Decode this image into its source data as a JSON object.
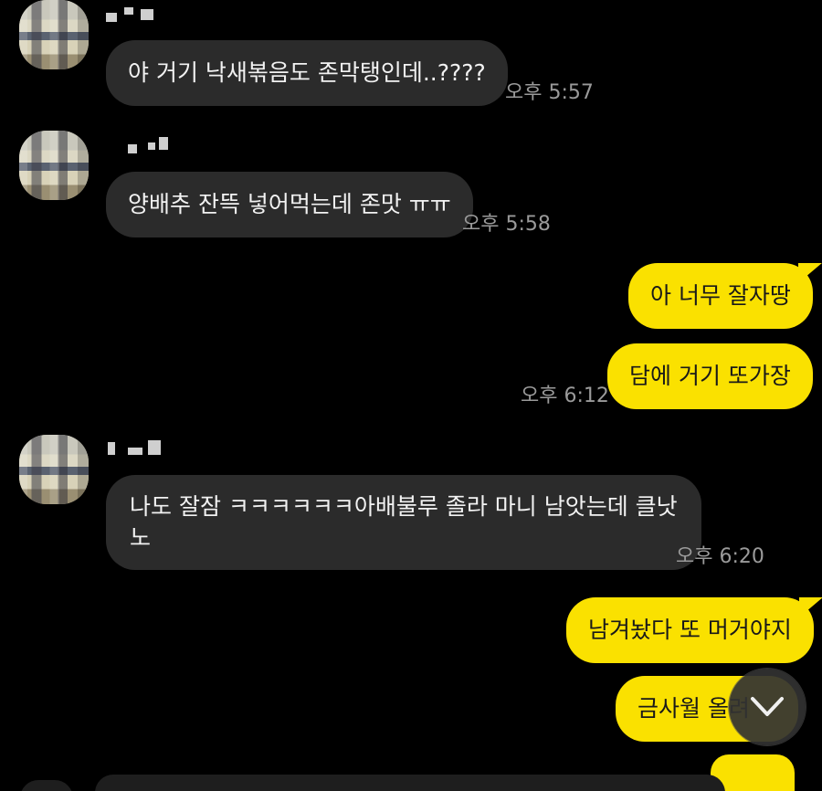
{
  "messages": [
    {
      "text": "야 거기 낙새볶음도 존막탱인데..????",
      "time": "오후 5:57"
    },
    {
      "text": "양배추 잔뜩 넣어먹는데 존맛 ㅠㅠ",
      "time": "오후 5:58"
    },
    {
      "text": "아 너무 잘자땅"
    },
    {
      "text": "담에 거기 또가장",
      "time": "오후 6:12"
    },
    {
      "text_line1": "나도 잘잠 ㅋㅋㅋㅋㅋㅋ아배불루 졸라 마니 남앗는데 클낫",
      "text_line2": "노",
      "time": "오후 6:20"
    },
    {
      "text": "남겨놨다 또 머거야지"
    },
    {
      "text": "금사월 올려"
    }
  ],
  "icons": {
    "scroll_down": "chevron-down-icon",
    "avatar": "avatar",
    "attach": "plus-icon"
  },
  "colors": {
    "background": "#000000",
    "incoming_bubble": "#2b2b2b",
    "outgoing_bubble": "#fae100",
    "timestamp": "#9a9a9a"
  }
}
